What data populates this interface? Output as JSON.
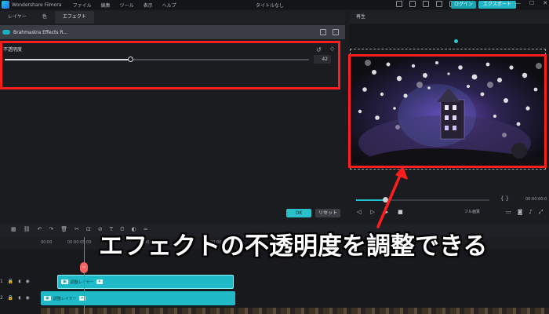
{
  "app": {
    "name": "Wondershare Filmora",
    "window_title": "タイトルなし",
    "menu": [
      "ファイル",
      "編集",
      "ツール",
      "表示",
      "ヘルプ"
    ],
    "login_label": "ログイン",
    "export_label": "エクスポート",
    "window_controls": [
      "—",
      "☐",
      "✕"
    ]
  },
  "left_panel": {
    "tabs": [
      {
        "label": "レイヤー",
        "active": false
      },
      {
        "label": "色",
        "active": false
      },
      {
        "label": "エフェクト",
        "active": true
      }
    ],
    "effect_name": "Brahmastra Effects R...",
    "opacity": {
      "label": "不透明度",
      "value": "42",
      "fraction": 0.42
    },
    "ok_label": "OK",
    "reset_label": "リセット"
  },
  "preview": {
    "header": "再生",
    "braces": "{ }",
    "timecode": "00:00:00:0",
    "quality": "フル画質",
    "progress_fraction": 0.22
  },
  "timeline": {
    "ruler_labels": [
      "00:00",
      "00:00:05:00",
      "00:00:10:00",
      "00:00:15:00",
      "00:00:20:00"
    ],
    "playhead_label": "✂",
    "tracks": [
      {
        "index": "1",
        "clip_label": "調整レイヤー"
      },
      {
        "index": "2",
        "clip_label": "調整レイヤー"
      }
    ]
  },
  "caption": "エフェクトの不透明度を調整できる",
  "colors": {
    "accent": "#20b9c8",
    "highlight_box": "#ff1e1e",
    "arrow": "#ff1e1e"
  }
}
